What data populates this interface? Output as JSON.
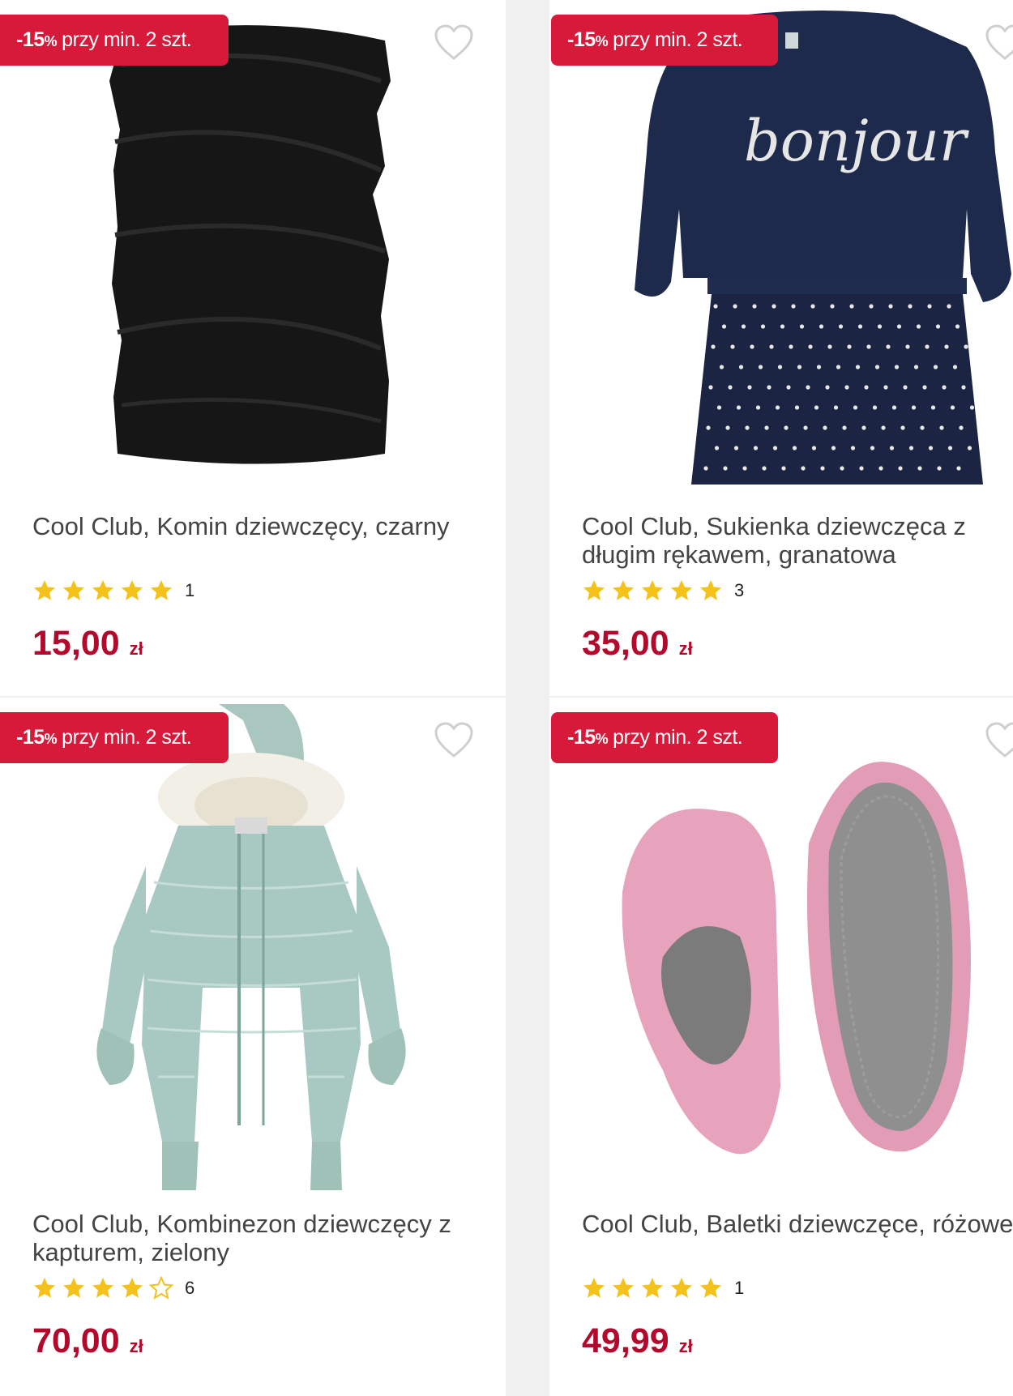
{
  "products": [
    {
      "badge_pct": "-15",
      "badge_pct_sign": "%",
      "badge_text": "przy min. 2 szt.",
      "title": "Cool Club, Komin dziewczęcy, czarny",
      "rating": 5,
      "rating_count": "1",
      "price": "15,00",
      "currency": "zł"
    },
    {
      "badge_pct": "-15",
      "badge_pct_sign": "%",
      "badge_text": "przy min. 2 szt.",
      "title": "Cool Club, Sukienka dziewczęca z długim rękawem, granatowa",
      "rating": 5,
      "rating_count": "3",
      "price": "35,00",
      "currency": "zł",
      "image_text": "bonjour"
    },
    {
      "badge_pct": "-15",
      "badge_pct_sign": "%",
      "badge_text": "przy min. 2 szt.",
      "title": "Cool Club, Kombinezon dziewczęcy z kapturem, zielony",
      "rating": 4,
      "rating_count": "6",
      "price": "70,00",
      "currency": "zł"
    },
    {
      "badge_pct": "-15",
      "badge_pct_sign": "%",
      "badge_text": "przy min. 2 szt.",
      "title": "Cool Club, Baletki dziewczęce, różowe",
      "rating": 5,
      "rating_count": "1",
      "price": "49,99",
      "currency": "zł"
    }
  ],
  "colors": {
    "badge": "#d7193a",
    "price": "#b3092d",
    "star": "#f5c21b"
  },
  "icons": {
    "favorite": "heart-outline-icon",
    "star_full": "star-icon",
    "star_empty": "star-outline-icon"
  }
}
